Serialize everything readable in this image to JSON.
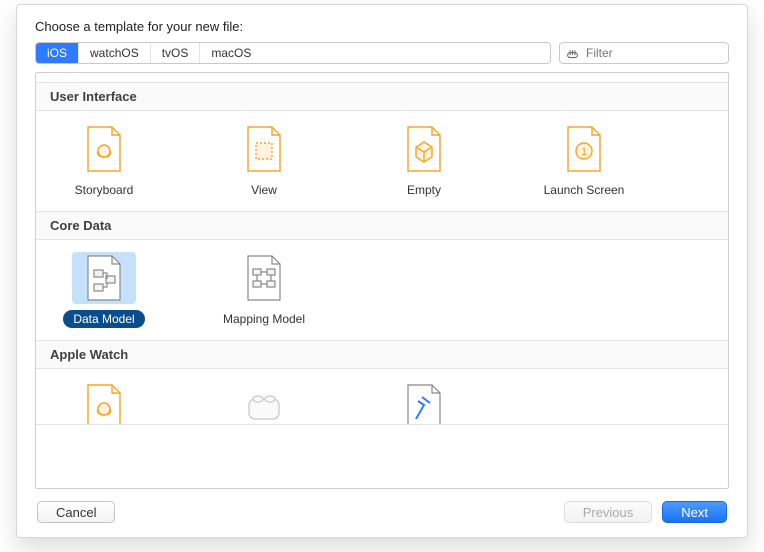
{
  "prompt": "Choose a template for your new file:",
  "tabs": {
    "ios": "iOS",
    "watchos": "watchOS",
    "tvos": "tvOS",
    "macos": "macOS",
    "selected": "ios"
  },
  "filter": {
    "placeholder": "Filter",
    "value": ""
  },
  "sections": {
    "ui": {
      "title": "User Interface",
      "items": {
        "storyboard": "Storyboard",
        "view": "View",
        "empty": "Empty",
        "launch": "Launch Screen"
      }
    },
    "coredata": {
      "title": "Core Data",
      "items": {
        "datamodel": "Data Model",
        "mapping": "Mapping Model"
      }
    },
    "applewatch": {
      "title": "Apple Watch"
    }
  },
  "selected_template": "datamodel",
  "buttons": {
    "cancel": "Cancel",
    "previous": "Previous",
    "next": "Next"
  }
}
